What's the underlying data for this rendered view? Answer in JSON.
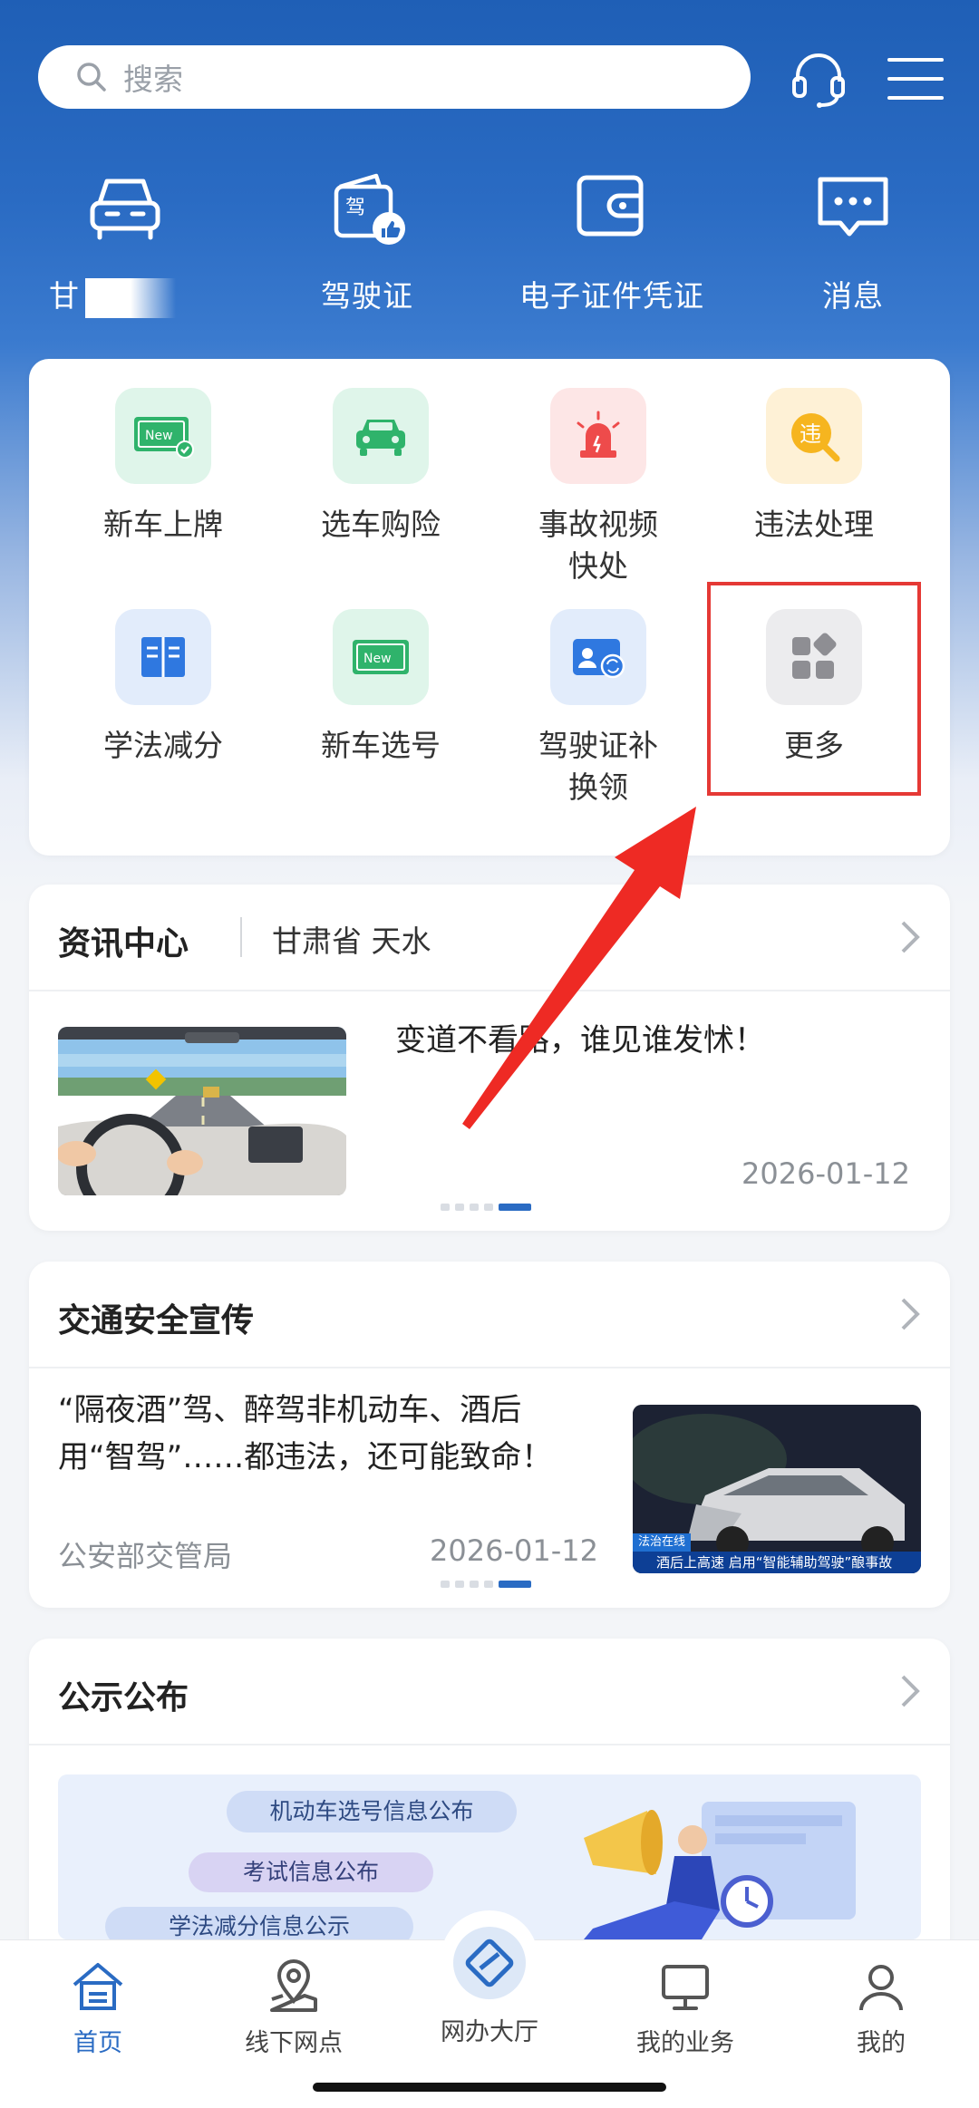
{
  "search": {
    "placeholder": "搜索"
  },
  "quick_actions": [
    {
      "icon": "car-icon",
      "label": "甘"
    },
    {
      "icon": "driver-license-icon",
      "label": "驾驶证"
    },
    {
      "icon": "wallet-icon",
      "label": "电子证件凭证"
    },
    {
      "icon": "message-icon",
      "label": "消息"
    }
  ],
  "services": [
    {
      "icon": "new-plate-icon",
      "label": "新车上牌"
    },
    {
      "icon": "car-insurance-icon",
      "label": "选车购险"
    },
    {
      "icon": "alarm-light-icon",
      "label": "事故视频快处"
    },
    {
      "icon": "violation-icon",
      "label": "违法处理"
    },
    {
      "icon": "book-icon",
      "label": "学法减分"
    },
    {
      "icon": "new-plate-select-icon",
      "label": "新车选号"
    },
    {
      "icon": "license-renew-icon",
      "label": "驾驶证补换领"
    },
    {
      "icon": "more-grid-icon",
      "label": "更多"
    }
  ],
  "news": {
    "title": "资讯中心",
    "location": "甘肃省 天水",
    "headline": "变道不看路，谁见谁发怵！",
    "date": "2026-01-12",
    "carousel_active": 5
  },
  "safety": {
    "title": "交通安全宣传",
    "headline": "“隔夜酒”驾、醉驾非机动车、酒后用“智驾”……都违法，还可能致命！",
    "source": "公安部交管局",
    "date": "2026-01-12",
    "thumb_caption_tag": "法治在线",
    "thumb_caption": "酒后上高速 启用“智能辅助驾驶”酿事故",
    "carousel_active": 5
  },
  "notices": {
    "title": "公示公布",
    "pills": [
      "机动车选号信息公布",
      "考试信息公布",
      "学法减分信息公示"
    ]
  },
  "bottom_nav": [
    {
      "icon": "home-icon",
      "label": "首页",
      "active": true
    },
    {
      "icon": "location-pin-icon",
      "label": "线下网点",
      "active": false
    },
    {
      "icon": "online-hall-icon",
      "label": "网办大厅",
      "active": false
    },
    {
      "icon": "monitor-icon",
      "label": "我的业务",
      "active": false
    },
    {
      "icon": "user-icon",
      "label": "我的",
      "active": false
    }
  ],
  "colors": {
    "brand": "#2a6bc3",
    "highlight_box": "#e53935",
    "arrow": "#e53935"
  }
}
